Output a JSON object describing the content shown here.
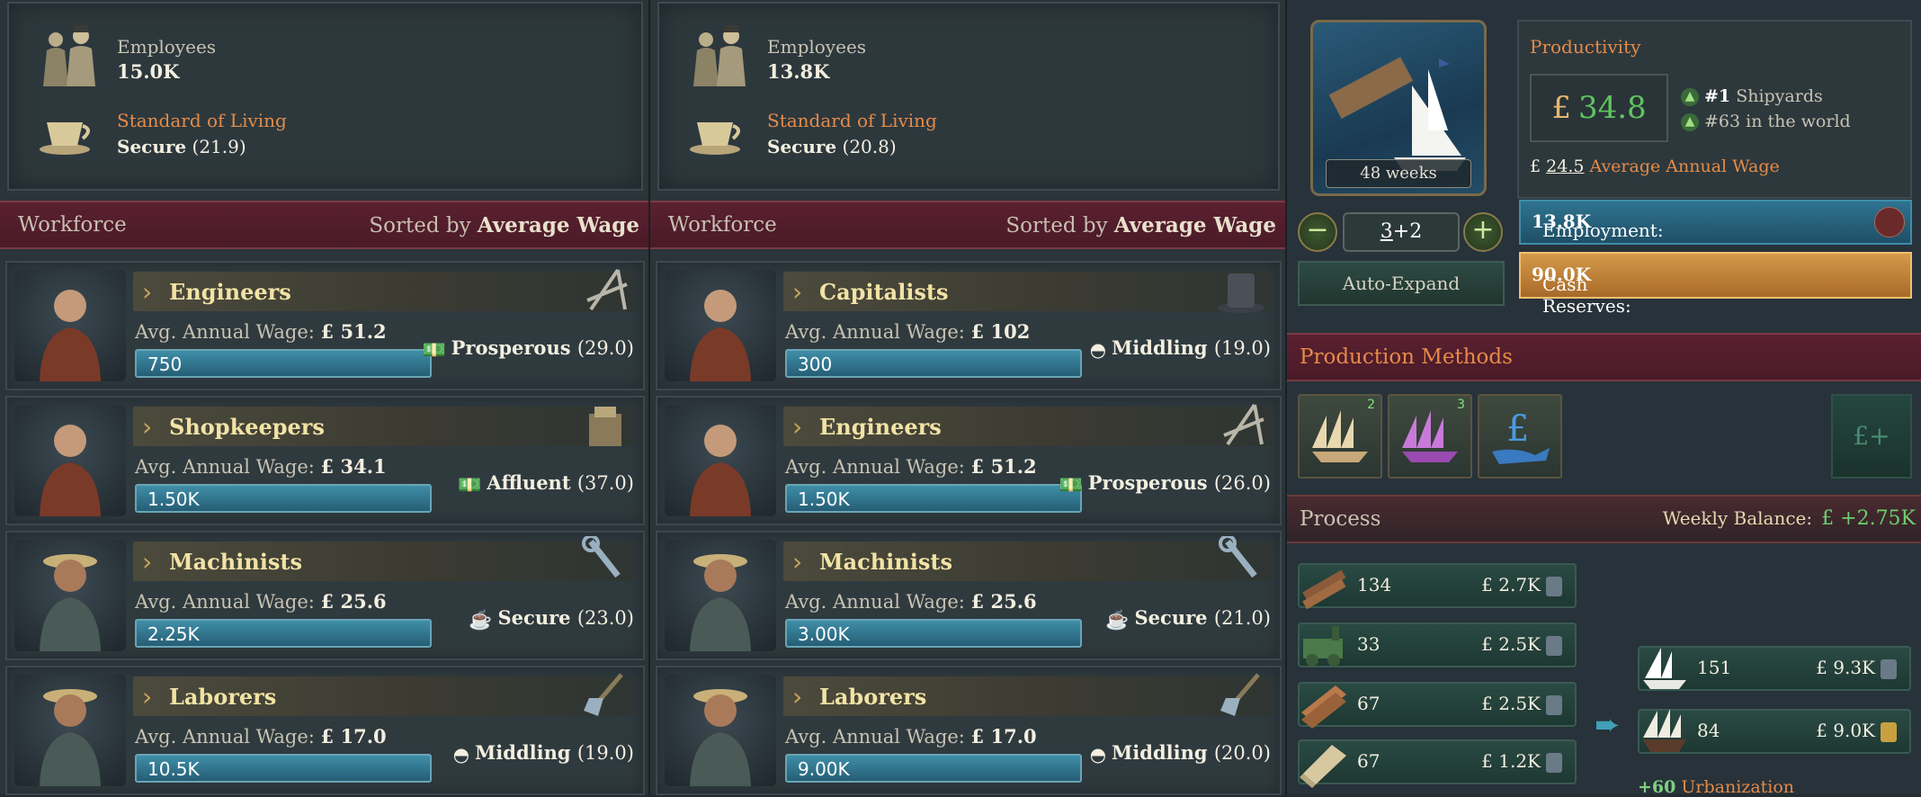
{
  "building_a": {
    "employees_label": "Employees",
    "employees_value": "15.0K",
    "sol_label": "Standard of Living",
    "sol_word": "Secure",
    "sol_num": "(21.9)",
    "workforce_label": "Workforce",
    "sorted_prefix": "Sorted by",
    "sorted_key": "Average Wage",
    "pops": [
      {
        "name": "Engineers",
        "wage_label": "Avg. Annual Wage:",
        "wage": "51.2",
        "count": "750",
        "sol_word": "Prosperous",
        "sol_num": "(29.0)",
        "icon": "compass-icon"
      },
      {
        "name": "Shopkeepers",
        "wage_label": "Avg. Annual Wage:",
        "wage": "34.1",
        "count": "1.50K",
        "sol_word": "Affluent",
        "sol_num": "(37.0)",
        "icon": "cash-register-icon"
      },
      {
        "name": "Machinists",
        "wage_label": "Avg. Annual Wage:",
        "wage": "25.6",
        "count": "2.25K",
        "sol_word": "Secure",
        "sol_num": "(23.0)",
        "icon": "wrench-icon"
      },
      {
        "name": "Laborers",
        "wage_label": "Avg. Annual Wage:",
        "wage": "17.0",
        "count": "10.5K",
        "sol_word": "Middling",
        "sol_num": "(19.0)",
        "icon": "shovel-icon"
      }
    ]
  },
  "building_b": {
    "employees_label": "Employees",
    "employees_value": "13.8K",
    "sol_label": "Standard of Living",
    "sol_word": "Secure",
    "sol_num": "(20.8)",
    "workforce_label": "Workforce",
    "sorted_prefix": "Sorted by",
    "sorted_key": "Average Wage",
    "pops": [
      {
        "name": "Capitalists",
        "wage_label": "Avg. Annual Wage:",
        "wage": "102",
        "count": "300",
        "sol_word": "Middling",
        "sol_num": "(19.0)",
        "icon": "top-hat-icon"
      },
      {
        "name": "Engineers",
        "wage_label": "Avg. Annual Wage:",
        "wage": "51.2",
        "count": "1.50K",
        "sol_word": "Prosperous",
        "sol_num": "(26.0)",
        "icon": "compass-icon"
      },
      {
        "name": "Machinists",
        "wage_label": "Avg. Annual Wage:",
        "wage": "25.6",
        "count": "3.00K",
        "sol_word": "Secure",
        "sol_num": "(21.0)",
        "icon": "wrench-icon"
      },
      {
        "name": "Laborers",
        "wage_label": "Avg. Annual Wage:",
        "wage": "17.0",
        "count": "9.00K",
        "sol_word": "Middling",
        "sol_num": "(20.0)",
        "icon": "shovel-icon"
      }
    ]
  },
  "building_panel": {
    "weeks": "48 weeks",
    "level_base": "3",
    "level_bonus": "+2",
    "minus": "−",
    "plus": "+",
    "auto_expand": "Auto-Expand",
    "productivity_label": "Productivity",
    "currency": "£",
    "productivity_value": "34.8",
    "rank1_num": "#1",
    "rank1_text": "Shipyards",
    "rank2_num": "#63",
    "rank2_text": "in the world",
    "avg_wage_value": "24.5",
    "avg_wage_label": "Average Annual Wage",
    "employment_label": "Employment:",
    "employment_value": "13.8K",
    "cash_label": "Cash Reserves:",
    "cash_value": "90.0K",
    "production_methods_label": "Production Methods",
    "pm_badges": [
      "2",
      "3"
    ],
    "pm_extra": "£+",
    "process_label": "Process",
    "weekly_balance_label": "Weekly Balance:",
    "weekly_balance_value": "+2.75K",
    "inputs": [
      {
        "icon": "logs-icon",
        "qty": "134",
        "price": "2.7K"
      },
      {
        "icon": "engine-icon",
        "qty": "33",
        "price": "2.5K"
      },
      {
        "icon": "planks-icon",
        "qty": "67",
        "price": "2.5K"
      },
      {
        "icon": "fabric-icon",
        "qty": "67",
        "price": "1.2K"
      }
    ],
    "outputs": [
      {
        "icon": "clipper-ship-icon",
        "qty": "151",
        "price": "9.3K"
      },
      {
        "icon": "man-o-war-icon",
        "qty": "84",
        "price": "9.0K"
      }
    ],
    "urbanization_value": "+60",
    "urbanization_label": "Urbanization"
  }
}
